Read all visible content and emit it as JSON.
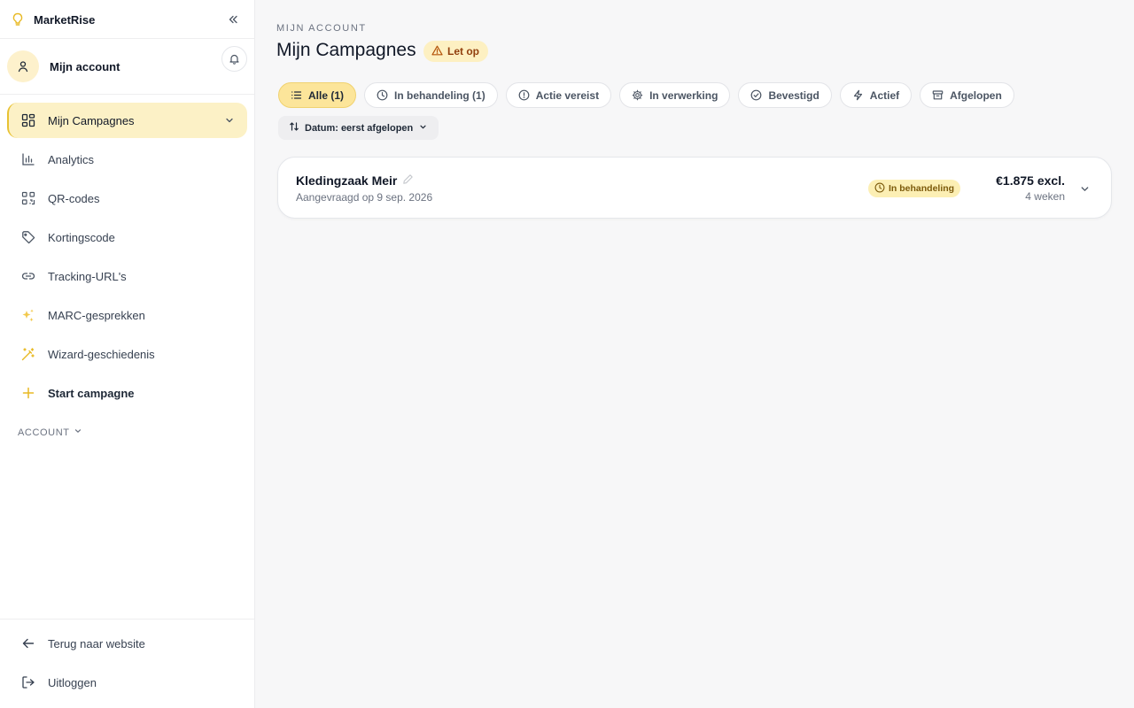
{
  "colors": {
    "accent": "#e8c232",
    "accent_soft": "#fcf1c6",
    "chip_active": "#fce59a",
    "warning_text": "#92400e"
  },
  "brand": {
    "name": "MarketRise",
    "icon": "lightbulb-icon"
  },
  "sidebar": {
    "account_label": "Mijn account",
    "nav": [
      {
        "label": "Mijn Campagnes",
        "icon": "dashboard-icon",
        "active": true
      },
      {
        "label": "Analytics",
        "icon": "bar-chart-icon"
      },
      {
        "label": "QR-codes",
        "icon": "qr-code-icon"
      },
      {
        "label": "Kortingscode",
        "icon": "tag-icon"
      },
      {
        "label": "Tracking-URL's",
        "icon": "link-icon"
      },
      {
        "label": "MARC-gesprekken",
        "icon": "sparkles-icon"
      },
      {
        "label": "Wizard-geschiedenis",
        "icon": "magic-wand-icon"
      },
      {
        "label": "Start campagne",
        "icon": "plus-icon"
      }
    ],
    "section_label": "ACCOUNT",
    "bottom": [
      {
        "label": "Terug naar website",
        "icon": "arrow-left-icon"
      },
      {
        "label": "Uitloggen",
        "icon": "logout-icon"
      }
    ]
  },
  "main": {
    "eyebrow": "MIJN ACCOUNT",
    "title": "Mijn Campagnes",
    "warning_badge": "Let op",
    "filters": [
      {
        "label": "Alle (1)",
        "icon": "list-icon",
        "active": true
      },
      {
        "label": "In behandeling (1)",
        "icon": "clock-icon"
      },
      {
        "label": "Actie vereist",
        "icon": "alert-circle-icon"
      },
      {
        "label": "In verwerking",
        "icon": "gear-icon"
      },
      {
        "label": "Bevestigd",
        "icon": "check-circle-icon"
      },
      {
        "label": "Actief",
        "icon": "bolt-icon"
      },
      {
        "label": "Afgelopen",
        "icon": "archive-icon"
      }
    ],
    "sort_label": "Datum: eerst afgelopen",
    "campaigns": [
      {
        "name": "Kledingzaak Meir",
        "requested": "Aangevraagd op 9 sep. 2026",
        "status": "In behandeling",
        "price": "€1.875 excl.",
        "duration": "4 weken"
      }
    ]
  }
}
